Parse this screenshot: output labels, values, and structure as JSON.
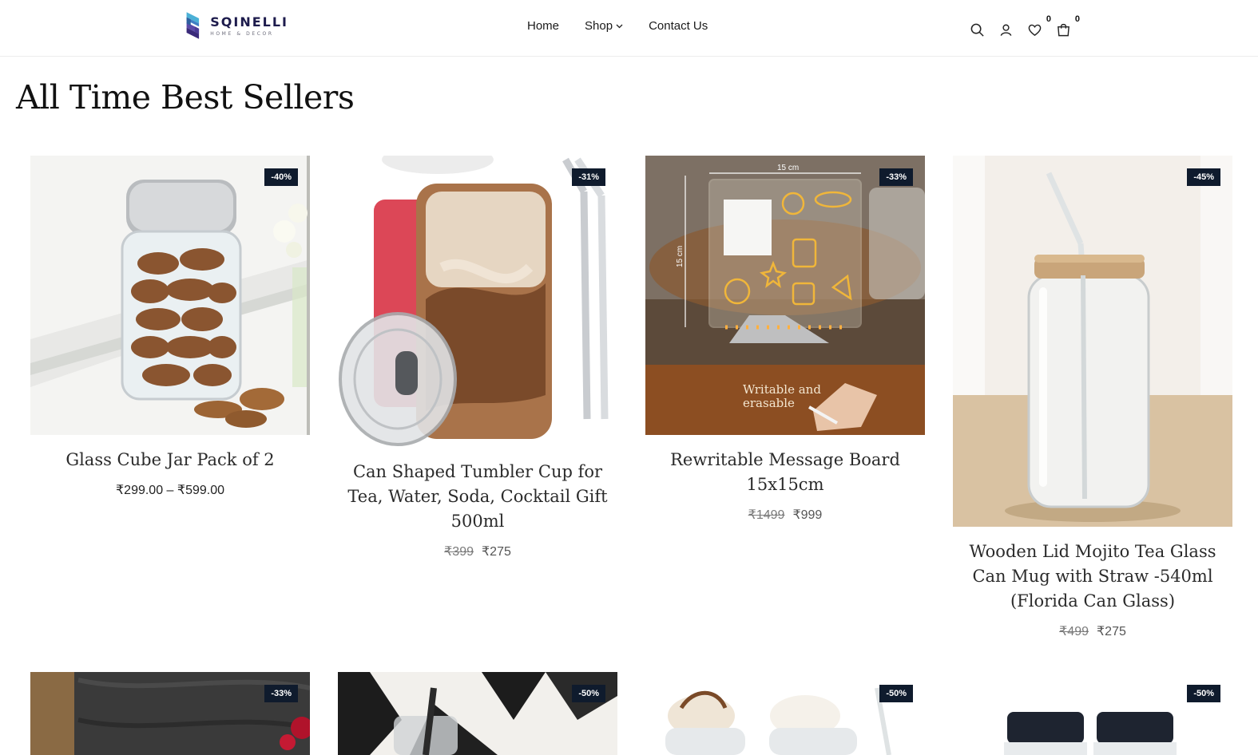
{
  "brand": {
    "name": "SQINELLI",
    "tagline": "HOME & DECOR"
  },
  "nav": {
    "home": "Home",
    "shop": "Shop",
    "contact": "Contact Us"
  },
  "header_counts": {
    "wishlist": "0",
    "cart": "0"
  },
  "page_title": "All Time Best Sellers",
  "products": [
    {
      "title": "Glass Cube Jar Pack of 2",
      "badge": "-40%",
      "price_range": "₹299.00 – ₹599.00"
    },
    {
      "title": "Can Shaped Tumbler Cup for Tea, Water, Soda, Cocktail Gift 500ml",
      "badge": "-31%",
      "old_price": "₹399",
      "new_price": "₹275"
    },
    {
      "title": "Rewritable Message Board 15x15cm",
      "badge": "-33%",
      "old_price": "₹1499",
      "new_price": "₹999",
      "image_text": {
        "width": "15 cm",
        "height": "15 cm",
        "caption1": "Writable and",
        "caption2": "erasable"
      }
    },
    {
      "title": "Wooden Lid Mojito Tea Glass Can Mug with Straw -540ml (Florida Can Glass)",
      "badge": "-45%",
      "old_price": "₹499",
      "new_price": "₹275"
    },
    {
      "badge": "-33%"
    },
    {
      "badge": "-50%"
    },
    {
      "badge": "-50%"
    },
    {
      "badge": "-50%"
    }
  ],
  "colors": {
    "badge_bg": "#0f1b2d",
    "text": "#111111",
    "border": "#ececec"
  },
  "icons": [
    "search-icon",
    "user-icon",
    "heart-icon",
    "cart-icon",
    "chevron-down-icon"
  ]
}
